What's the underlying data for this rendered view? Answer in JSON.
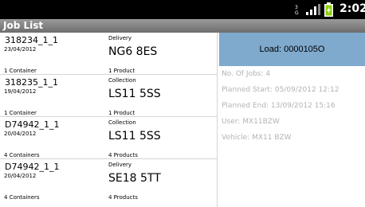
{
  "status_bar": {
    "network": "3G",
    "time": "2:02"
  },
  "title": "Job List",
  "jobs": [
    {
      "id": "318234_1_1",
      "date": "23/04/2012",
      "containers": "1 Container",
      "type": "Delivery",
      "postcode": "NG6 8ES",
      "products": "1 Product"
    },
    {
      "id": "318235_1_1",
      "date": "19/04/2012",
      "containers": "1 Container",
      "type": "Collection",
      "postcode": "LS11 5SS",
      "products": "1 Product"
    },
    {
      "id": "D74942_1_1",
      "date": "20/04/2012",
      "containers": "4 Containers",
      "type": "Collection",
      "postcode": "LS11 5SS",
      "products": "4 Products"
    },
    {
      "id": "D74942_1_1",
      "date": "20/04/2012",
      "containers": "4 Containers",
      "type": "Delivery",
      "postcode": "SE18 5TT",
      "products": "4 Products"
    }
  ],
  "load": {
    "button_label": "Load: 0000105O",
    "no_of_jobs": "No. Of Jobs: 4",
    "planned_start": "Planned Start: 05/09/2012 12:12",
    "planned_end": "Planned End: 13/09/2012 15:16",
    "user": "User: MX11BZW",
    "vehicle": "Vehicle: MX11 BZW"
  },
  "colors": {
    "accent": "#7fa9cd",
    "title_bar": "#7b7b7b",
    "status_bar": "#000000",
    "info_text": "#b3b3b3",
    "battery": "#8ccf00"
  },
  "icons": [
    "3g-icon",
    "signal-icon",
    "battery-icon"
  ]
}
